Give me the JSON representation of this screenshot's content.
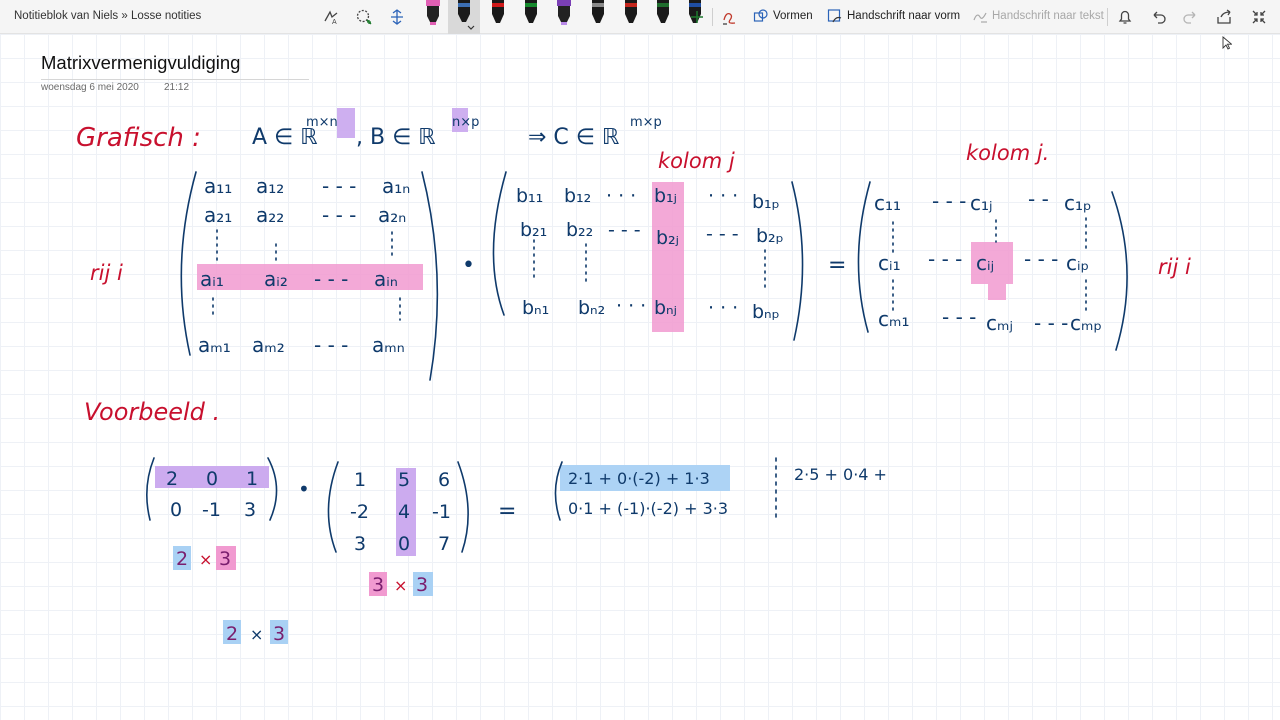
{
  "breadcrumb": "Notitieblok van Niels » Losse notities",
  "toolbar": {
    "commands": {
      "shapes": "Vormen",
      "ink_to_shape": "Handschrift naar vorm",
      "ink_to_text": "Handschrift naar tekst"
    },
    "pens": [
      {
        "name": "pen-pink",
        "color": "#e05fb4"
      },
      {
        "name": "pen-black",
        "color": "#1a1a1a"
      },
      {
        "name": "pen-red",
        "color": "#d01b1b"
      },
      {
        "name": "pen-green",
        "color": "#178a2e"
      },
      {
        "name": "pen-purple",
        "color": "#7a3fb5"
      },
      {
        "name": "pen-gray",
        "color": "#8a8a8a"
      },
      {
        "name": "pen-red2",
        "color": "#c4261d"
      },
      {
        "name": "pen-darkgreen",
        "color": "#206e2e"
      },
      {
        "name": "pen-blue",
        "color": "#1f4ea3"
      }
    ],
    "icons": [
      "lasso-icon",
      "add-space-icon",
      "add-pen-icon",
      "ink-replay-icon",
      "notifications-icon",
      "undo-icon",
      "redo-icon",
      "share-icon",
      "fullscreen-icon"
    ]
  },
  "page": {
    "title": "Matrixvermenigvuldiging",
    "date": "woensdag 6 mei 2020",
    "time": "21:12"
  },
  "ink": {
    "colors": {
      "red": "#c8102e",
      "blue": "#0f3a6b",
      "pink_highlight": "#f19ad0",
      "purple_highlight": "#c9a6ee",
      "blue_highlight": "#a9d1f4"
    },
    "grafisch_label": "Grafisch :",
    "set_A": "A ∈ ℝ",
    "set_A_exp": "m×n",
    "set_B": ", B ∈ ℝ",
    "set_B_exp": "n×p",
    "implies": "⇒  C ∈ ℝ",
    "set_C_exp": "m×p",
    "kolom_j_1": "kolom j",
    "kolom_j_2": "kolom j.",
    "rij_i_1": "rij i",
    "rij_i_2": "rij i",
    "matrix_A": {
      "row1": [
        "a₁₁",
        "a₁₂",
        "- - -",
        "a₁ₙ"
      ],
      "row2": [
        "a₂₁",
        "a₂₂",
        "- - -",
        "a₂ₙ"
      ],
      "rowi": [
        "aᵢ₁",
        "aᵢ₂",
        "- - -",
        "aᵢₙ"
      ],
      "rowm": [
        "aₘ₁",
        "aₘ₂",
        "- - -",
        "aₘₙ"
      ]
    },
    "matrix_B": {
      "row1": [
        "b₁₁",
        "b₁₂",
        "· · ·",
        "b₁ⱼ",
        "· · ·",
        "b₁ₚ"
      ],
      "row2": [
        "b₂₁",
        "b₂₂",
        "- - -",
        "b₂ⱼ",
        "- - -",
        "b₂ₚ"
      ],
      "rown": [
        "bₙ₁",
        "bₙ₂",
        "· · ·",
        "bₙⱼ",
        "· · ·",
        "bₙₚ"
      ]
    },
    "matrix_C": {
      "row1": [
        "c₁₁",
        "- - -",
        "c₁ⱼ",
        "- -",
        "c₁ₚ"
      ],
      "rowi": [
        "cᵢ₁",
        "- - -",
        "cᵢⱼ",
        "- - -",
        "cᵢₚ"
      ],
      "rowm": [
        "cₘ₁",
        "- - -",
        "cₘⱼ",
        "- - -",
        "cₘₚ"
      ]
    },
    "dot": "•",
    "equals": "=",
    "voorbeeld_label": "Voorbeeld .",
    "ex_A": [
      [
        "2",
        "0",
        "1"
      ],
      [
        "0",
        "-1",
        "3"
      ]
    ],
    "ex_B": [
      [
        "1",
        "5",
        "6"
      ],
      [
        "-2",
        "4",
        "-1"
      ],
      [
        "3",
        "0",
        "7"
      ]
    ],
    "ex_C_row1": "2·1 + 0·(-2) + 1·3",
    "ex_C_row2": "0·1 + (-1)·(-2) + 3·3",
    "ex_side": "2·5 + 0·4 +",
    "dim_A": [
      "2",
      "×",
      "3"
    ],
    "dim_B": [
      "3",
      "×",
      "3"
    ],
    "dim_C": [
      "2",
      "×",
      "3"
    ]
  }
}
